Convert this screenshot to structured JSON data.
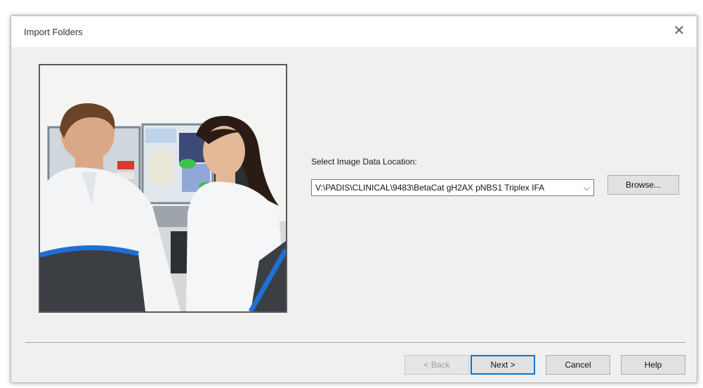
{
  "window": {
    "title": "Import Folders",
    "close_icon": "close-icon",
    "close_glyph": "✕"
  },
  "image": {
    "description_icon": "illustration-lab-scientists"
  },
  "location": {
    "label": "Select Image Data Location:",
    "value": "V:\\PADIS\\CLINICAL\\9483\\BetaCat gH2AX pNBS1 Triplex IFA",
    "chevron_icon": "chevron-down-icon",
    "chevron_glyph": "⌵"
  },
  "buttons": {
    "browse": "Browse...",
    "back": "< Back",
    "next": "Next >",
    "cancel": "Cancel",
    "help": "Help"
  },
  "colors": {
    "dialog_bg": "#f0f0f0",
    "accent": "#0078d7"
  }
}
